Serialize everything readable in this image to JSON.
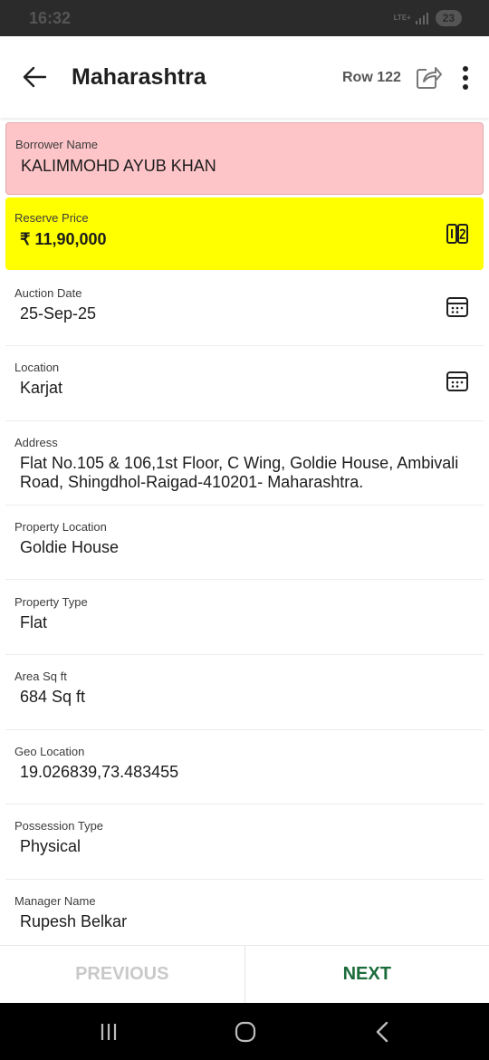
{
  "status_bar": {
    "time": "16:32",
    "network": "LTE+",
    "battery": "23"
  },
  "header": {
    "title": "Maharashtra",
    "row": "Row 122",
    "icons": [
      "arrow-left-icon",
      "share-icon",
      "more-vert-icon"
    ]
  },
  "colors": {
    "borrower_bg": "#fec5c9",
    "reserve_bg": "#ffff00",
    "next_color": "#1b6b3a",
    "prev_color": "#c9c9c9"
  },
  "fields": {
    "borrower": {
      "label": "Borrower Name",
      "value": "KALIMMOHD AYUB KHAN"
    },
    "reserve": {
      "label": "Reserve Price",
      "value": "₹ 11,90,000",
      "icon": "compare-icon"
    },
    "auction_date": {
      "label": "Auction Date",
      "value": "25-Sep-25",
      "icon": "calendar-icon"
    },
    "location": {
      "label": "Location",
      "value": "Karjat",
      "icon": "calendar-icon"
    },
    "address": {
      "label": "Address",
      "value": "Flat No.105 & 106,1st Floor, C Wing, Goldie House, Ambivali Road, Shingdhol-Raigad-410201- Maharashtra."
    },
    "property_location": {
      "label": "Property Location",
      "value": "Goldie House"
    },
    "property_type": {
      "label": "Property Type",
      "value": "Flat"
    },
    "area": {
      "label": "Area Sq ft",
      "value": "684 Sq ft"
    },
    "geo": {
      "label": "Geo Location",
      "value": "19.026839,73.483455"
    },
    "possession": {
      "label": "Possession Type",
      "value": "Physical"
    },
    "manager": {
      "label": "Manager Name",
      "value": "Rupesh Belkar"
    }
  },
  "bottom_nav": {
    "previous": "PREVIOUS",
    "next": "NEXT"
  }
}
